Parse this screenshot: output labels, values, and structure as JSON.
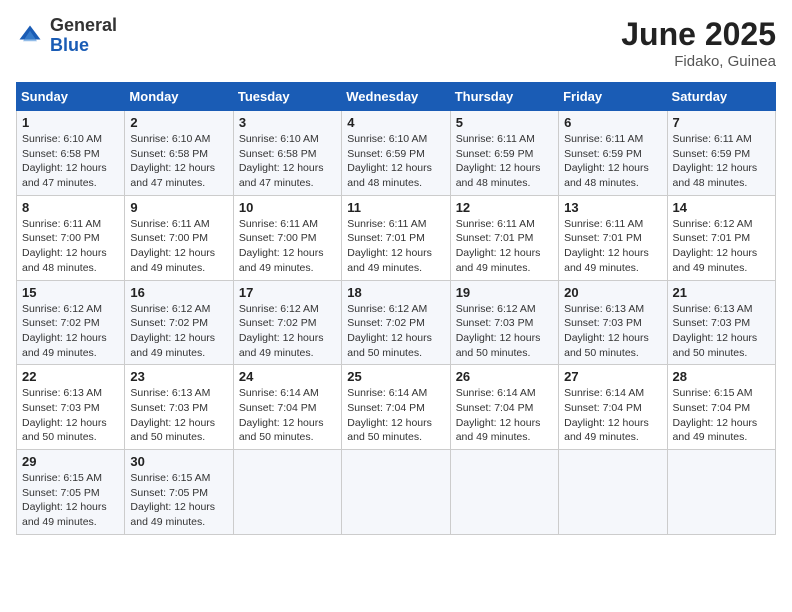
{
  "header": {
    "logo_general": "General",
    "logo_blue": "Blue",
    "month": "June 2025",
    "location": "Fidako, Guinea"
  },
  "days_of_week": [
    "Sunday",
    "Monday",
    "Tuesday",
    "Wednesday",
    "Thursday",
    "Friday",
    "Saturday"
  ],
  "weeks": [
    [
      {
        "day": 1,
        "sunrise": "6:10 AM",
        "sunset": "6:58 PM",
        "daylight": "12 hours and 47 minutes."
      },
      {
        "day": 2,
        "sunrise": "6:10 AM",
        "sunset": "6:58 PM",
        "daylight": "12 hours and 47 minutes."
      },
      {
        "day": 3,
        "sunrise": "6:10 AM",
        "sunset": "6:58 PM",
        "daylight": "12 hours and 47 minutes."
      },
      {
        "day": 4,
        "sunrise": "6:10 AM",
        "sunset": "6:59 PM",
        "daylight": "12 hours and 48 minutes."
      },
      {
        "day": 5,
        "sunrise": "6:11 AM",
        "sunset": "6:59 PM",
        "daylight": "12 hours and 48 minutes."
      },
      {
        "day": 6,
        "sunrise": "6:11 AM",
        "sunset": "6:59 PM",
        "daylight": "12 hours and 48 minutes."
      },
      {
        "day": 7,
        "sunrise": "6:11 AM",
        "sunset": "6:59 PM",
        "daylight": "12 hours and 48 minutes."
      }
    ],
    [
      {
        "day": 8,
        "sunrise": "6:11 AM",
        "sunset": "7:00 PM",
        "daylight": "12 hours and 48 minutes."
      },
      {
        "day": 9,
        "sunrise": "6:11 AM",
        "sunset": "7:00 PM",
        "daylight": "12 hours and 49 minutes."
      },
      {
        "day": 10,
        "sunrise": "6:11 AM",
        "sunset": "7:00 PM",
        "daylight": "12 hours and 49 minutes."
      },
      {
        "day": 11,
        "sunrise": "6:11 AM",
        "sunset": "7:01 PM",
        "daylight": "12 hours and 49 minutes."
      },
      {
        "day": 12,
        "sunrise": "6:11 AM",
        "sunset": "7:01 PM",
        "daylight": "12 hours and 49 minutes."
      },
      {
        "day": 13,
        "sunrise": "6:11 AM",
        "sunset": "7:01 PM",
        "daylight": "12 hours and 49 minutes."
      },
      {
        "day": 14,
        "sunrise": "6:12 AM",
        "sunset": "7:01 PM",
        "daylight": "12 hours and 49 minutes."
      }
    ],
    [
      {
        "day": 15,
        "sunrise": "6:12 AM",
        "sunset": "7:02 PM",
        "daylight": "12 hours and 49 minutes."
      },
      {
        "day": 16,
        "sunrise": "6:12 AM",
        "sunset": "7:02 PM",
        "daylight": "12 hours and 49 minutes."
      },
      {
        "day": 17,
        "sunrise": "6:12 AM",
        "sunset": "7:02 PM",
        "daylight": "12 hours and 49 minutes."
      },
      {
        "day": 18,
        "sunrise": "6:12 AM",
        "sunset": "7:02 PM",
        "daylight": "12 hours and 50 minutes."
      },
      {
        "day": 19,
        "sunrise": "6:12 AM",
        "sunset": "7:03 PM",
        "daylight": "12 hours and 50 minutes."
      },
      {
        "day": 20,
        "sunrise": "6:13 AM",
        "sunset": "7:03 PM",
        "daylight": "12 hours and 50 minutes."
      },
      {
        "day": 21,
        "sunrise": "6:13 AM",
        "sunset": "7:03 PM",
        "daylight": "12 hours and 50 minutes."
      }
    ],
    [
      {
        "day": 22,
        "sunrise": "6:13 AM",
        "sunset": "7:03 PM",
        "daylight": "12 hours and 50 minutes."
      },
      {
        "day": 23,
        "sunrise": "6:13 AM",
        "sunset": "7:03 PM",
        "daylight": "12 hours and 50 minutes."
      },
      {
        "day": 24,
        "sunrise": "6:14 AM",
        "sunset": "7:04 PM",
        "daylight": "12 hours and 50 minutes."
      },
      {
        "day": 25,
        "sunrise": "6:14 AM",
        "sunset": "7:04 PM",
        "daylight": "12 hours and 50 minutes."
      },
      {
        "day": 26,
        "sunrise": "6:14 AM",
        "sunset": "7:04 PM",
        "daylight": "12 hours and 49 minutes."
      },
      {
        "day": 27,
        "sunrise": "6:14 AM",
        "sunset": "7:04 PM",
        "daylight": "12 hours and 49 minutes."
      },
      {
        "day": 28,
        "sunrise": "6:15 AM",
        "sunset": "7:04 PM",
        "daylight": "12 hours and 49 minutes."
      }
    ],
    [
      {
        "day": 29,
        "sunrise": "6:15 AM",
        "sunset": "7:05 PM",
        "daylight": "12 hours and 49 minutes."
      },
      {
        "day": 30,
        "sunrise": "6:15 AM",
        "sunset": "7:05 PM",
        "daylight": "12 hours and 49 minutes."
      },
      null,
      null,
      null,
      null,
      null
    ]
  ]
}
